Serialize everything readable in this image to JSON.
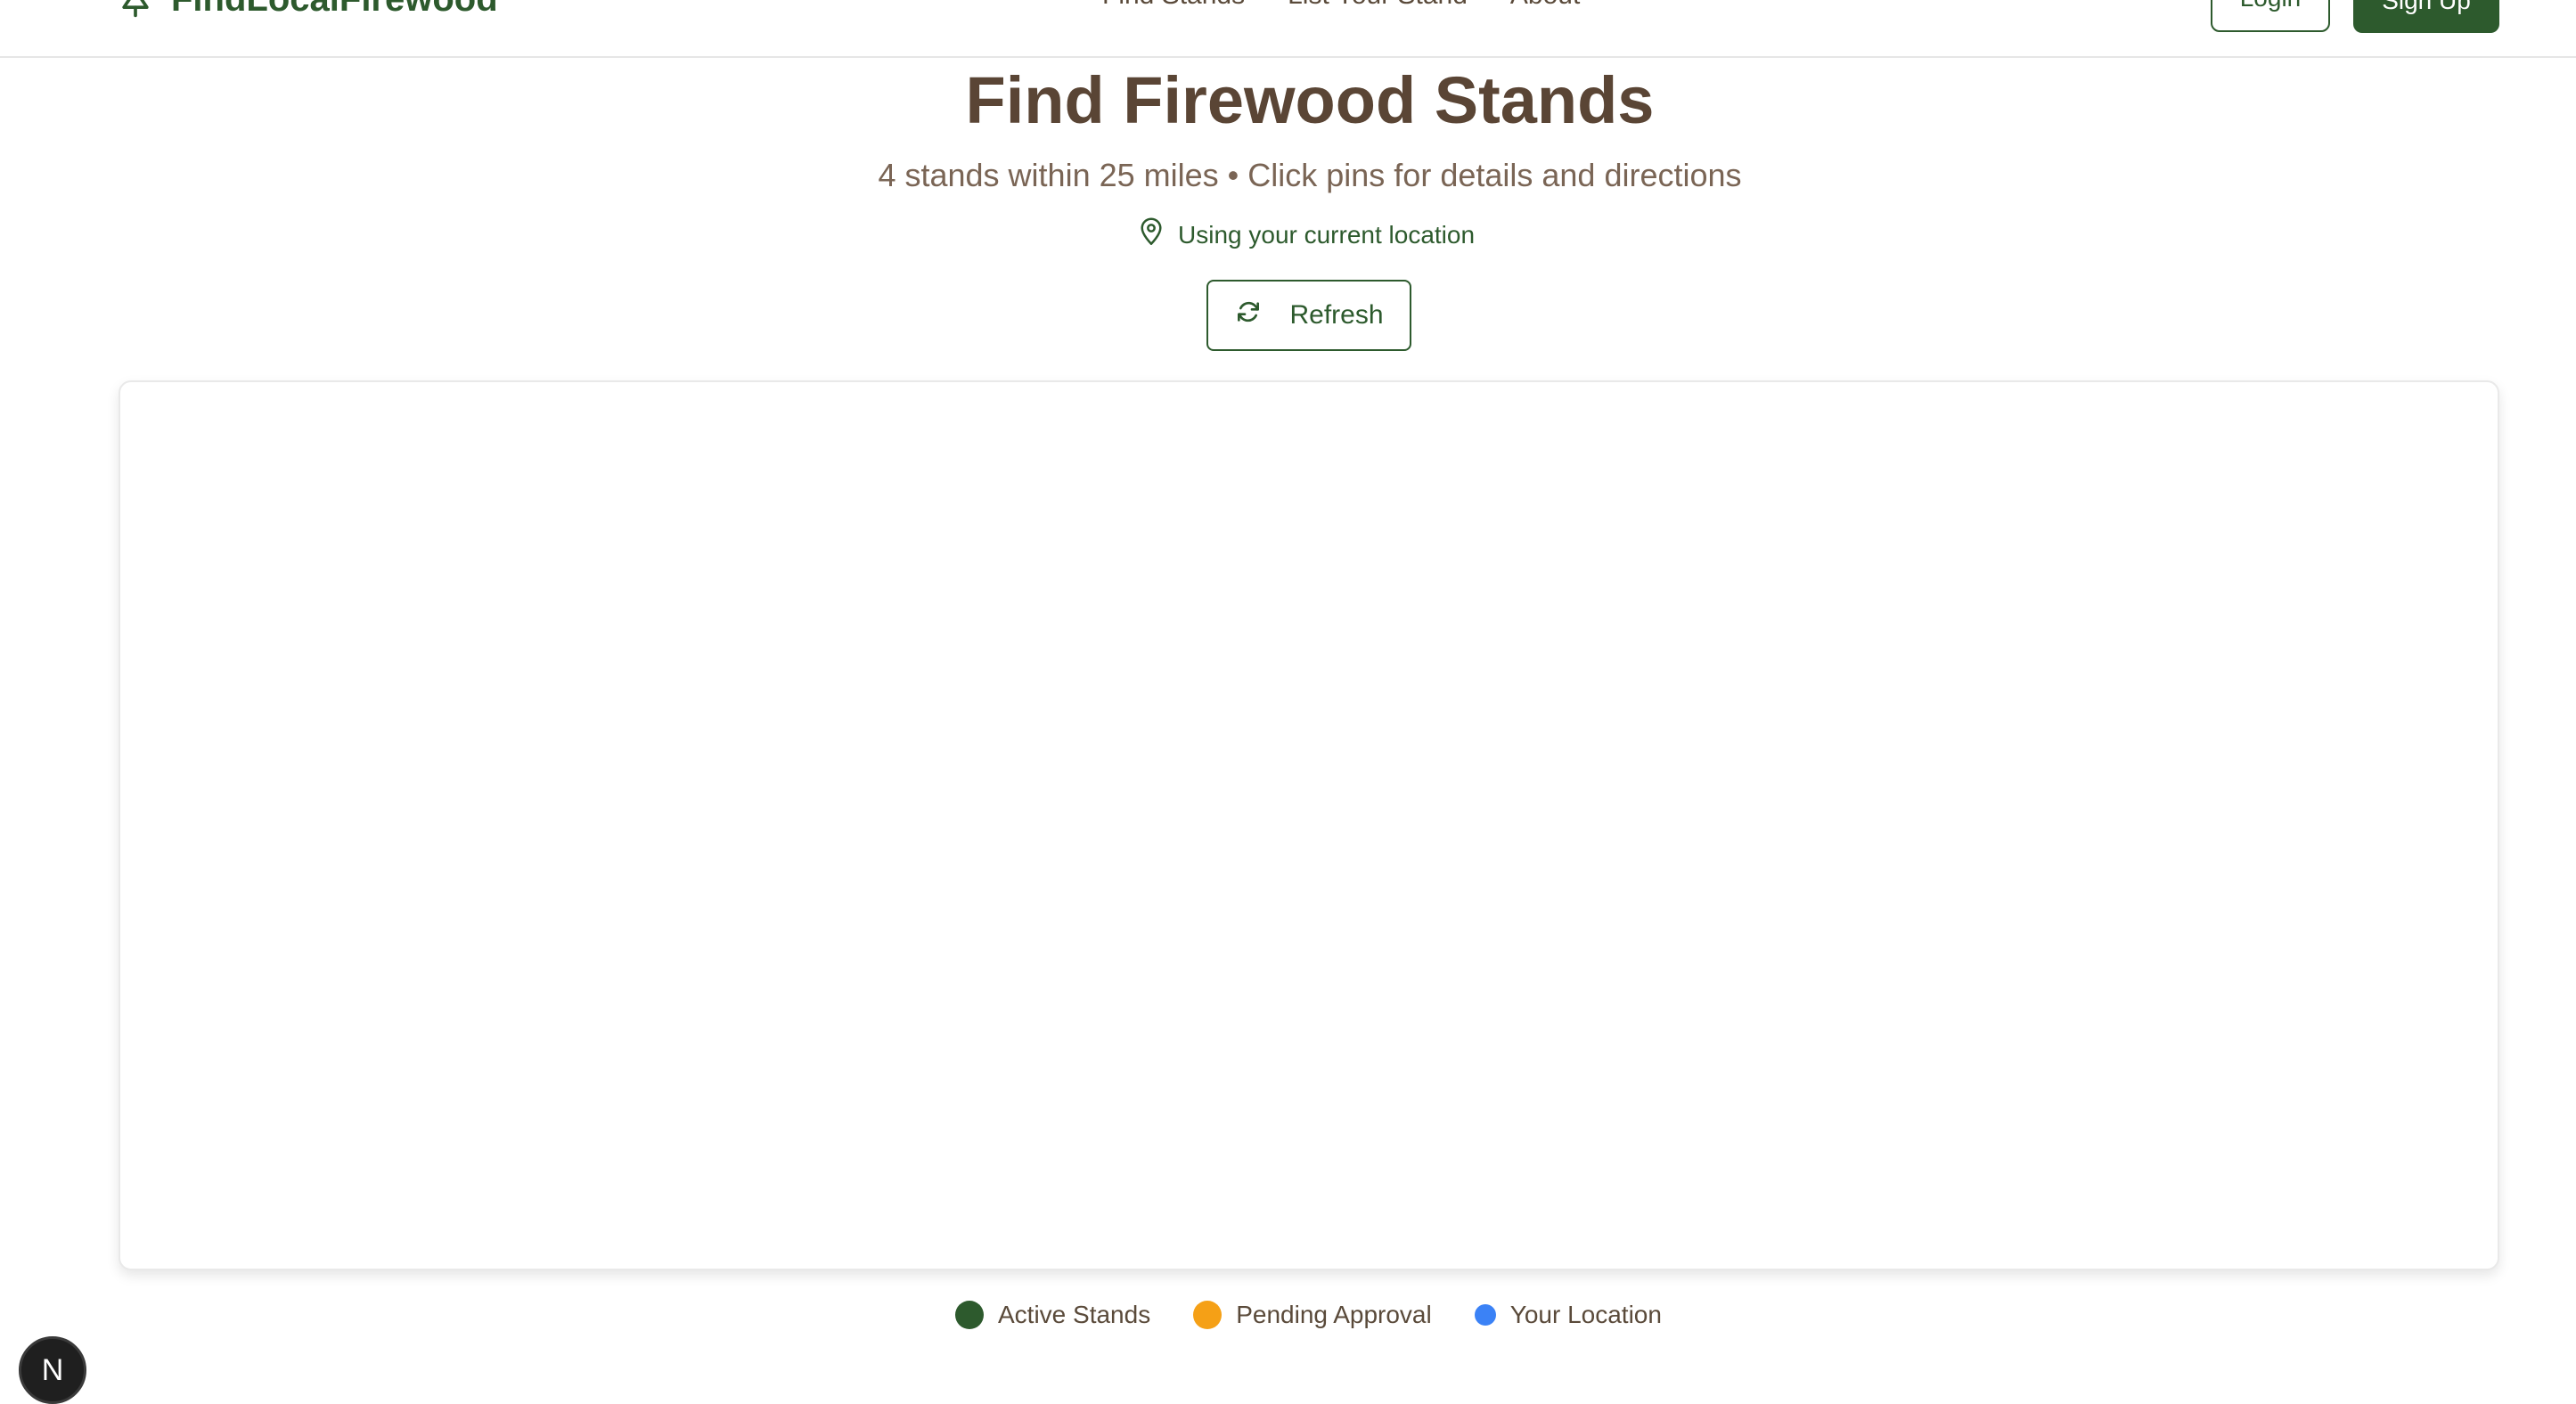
{
  "header": {
    "brand": "FindLocalFirewood",
    "nav": [
      {
        "label": "Find Stands"
      },
      {
        "label": "List Your Stand"
      },
      {
        "label": "About"
      }
    ],
    "login_label": "Login",
    "signup_label": "Sign Up"
  },
  "main": {
    "title": "Find Firewood Stands",
    "subtitle": "4 stands within 25 miles • Click pins for details and directions",
    "location_text": "Using your current location",
    "refresh_label": "Refresh"
  },
  "legend": [
    {
      "label": "Active Stands",
      "color": "#2d5a2d"
    },
    {
      "label": "Pending Approval",
      "color": "#f5a016"
    },
    {
      "label": "Your Location",
      "color": "#3b82f6"
    }
  ],
  "dev_badge": {
    "letter": "N"
  },
  "colors": {
    "brand": "#2d5a2d",
    "title": "#5a4535",
    "subtitle": "#7a6555"
  }
}
